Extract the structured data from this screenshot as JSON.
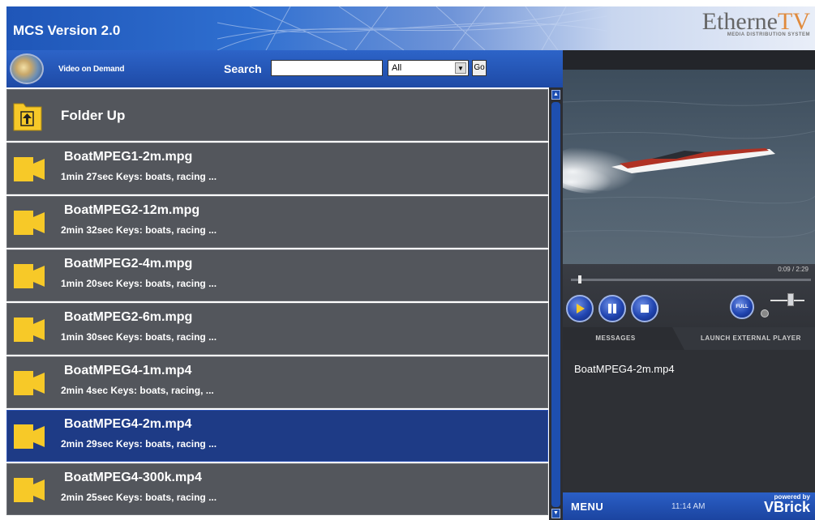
{
  "header": {
    "app_title": "MCS Version 2.0",
    "brand_name_prefix": "Etherne",
    "brand_name_suffix": "TV",
    "brand_subtitle": "MEDIA DISTRIBUTION SYSTEM"
  },
  "toolbar": {
    "section_label": "Video on Demand",
    "search_label": "Search",
    "search_value": "",
    "filter_selected": "All",
    "go_label": "Go"
  },
  "files": [
    {
      "name": "Folder Up",
      "meta": ""
    },
    {
      "name": "BoatMPEG1-2m.mpg",
      "meta": "1min 27sec Keys: boats, racing ..."
    },
    {
      "name": "BoatMPEG2-12m.mpg",
      "meta": "2min 32sec Keys: boats, racing ..."
    },
    {
      "name": "BoatMPEG2-4m.mpg",
      "meta": "1min 20sec Keys: boats, racing ..."
    },
    {
      "name": "BoatMPEG2-6m.mpg",
      "meta": "1min 30sec Keys: boats, racing ..."
    },
    {
      "name": "BoatMPEG4-1m.mp4",
      "meta": "2min 4sec Keys: boats, racing, ..."
    },
    {
      "name": "BoatMPEG4-2m.mp4",
      "meta": "2min 29sec Keys: boats, racing ..."
    },
    {
      "name": "BoatMPEG4-300k.mp4",
      "meta": "2min 25sec Keys: boats, racing ..."
    }
  ],
  "selected_index": 6,
  "player": {
    "time": "0:09 / 2:29",
    "progress": 0.03,
    "full_label": "FULL",
    "volume": 0.6
  },
  "tabs": {
    "messages": "MESSAGES",
    "launch": "LAUNCH EXTERNAL PLAYER"
  },
  "messages": {
    "text": "BoatMPEG4-2m.mp4"
  },
  "footer": {
    "menu": "MENU",
    "clock": "11:14 AM",
    "powered_by": "powered by",
    "brand": "VBrick"
  },
  "colors": {
    "header_blue": "#1f56b8",
    "row_gray": "#53565c",
    "selected_row": "#1e3b86",
    "folder_yellow": "#f7c928"
  }
}
